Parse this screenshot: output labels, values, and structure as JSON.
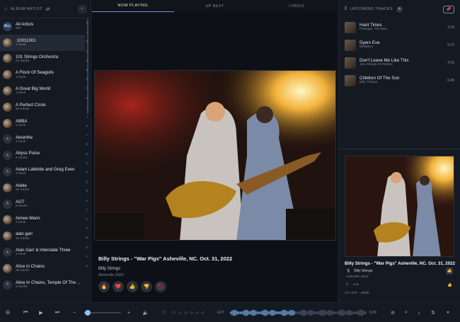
{
  "left_panel": {
    "header_label": "ALBUM ARTIST",
    "artists": [
      {
        "name": "All Artists",
        "sub": "397",
        "avatar": "ALL"
      },
      {
        "name": ".10011001",
        "sub": "1 track",
        "avatar": ""
      },
      {
        "name": "101 Strings Orchestra",
        "sub": "22 tracks",
        "avatar": ""
      },
      {
        "name": "A Flock Of Seagulls",
        "sub": "1 track",
        "avatar": ""
      },
      {
        "name": "A Great Big World",
        "sub": "1 track",
        "avatar": ""
      },
      {
        "name": "A Perfect Circle",
        "sub": "50 tracks",
        "avatar": ""
      },
      {
        "name": "ABBA",
        "sub": "1 track",
        "avatar": ""
      },
      {
        "name": "Absinthe",
        "sub": "1 track",
        "avatar": "A"
      },
      {
        "name": "Abyss Pulse",
        "sub": "2 tracks",
        "avatar": "A"
      },
      {
        "name": "Adam LaMotte and Greg Ewer",
        "sub": "1 track",
        "avatar": "A"
      },
      {
        "name": "Adele",
        "sub": "34 tracks",
        "avatar": ""
      },
      {
        "name": "AGT",
        "sub": "5 tracks",
        "avatar": "A"
      },
      {
        "name": "Aimee Mann",
        "sub": "1 track",
        "avatar": ""
      },
      {
        "name": "alan garr",
        "sub": "10 tracks",
        "avatar": ""
      },
      {
        "name": "Alan Garr & Interstate Three",
        "sub": "1 track",
        "avatar": "A"
      },
      {
        "name": "Alice in Chains",
        "sub": "36 tracks",
        "avatar": ""
      },
      {
        "name": "Alice In Chains, Temple Of The ...",
        "sub": "3 tracks",
        "avatar": "A"
      }
    ],
    "alphabet": [
      "#",
      "A",
      "B",
      "C",
      "D",
      "E",
      "F",
      "G",
      "H",
      "I",
      "J",
      "K",
      "L",
      "M",
      "N",
      "O",
      "P",
      "Q",
      "R",
      "S",
      "T",
      "U",
      "V",
      "W",
      "X",
      "Y",
      "Z"
    ]
  },
  "tabs": [
    {
      "label": "NOW PLAYING",
      "active": true
    },
    {
      "label": "UP NEXT",
      "active": false
    },
    {
      "label": "LYRICS",
      "active": false
    }
  ],
  "now_playing": {
    "title": "Billy Strings - \"War Pigs\" Asheville, NC. Oct. 31, 2022",
    "artist": "Billy Strings",
    "album": "Asheville 2022",
    "reactions": [
      "🔥",
      "❤️",
      "👍",
      "👎",
      "🚫"
    ]
  },
  "upcoming": {
    "header_label": "UPCOMING TRACKS",
    "count": "4",
    "tracks": [
      {
        "title": "Hard Times",
        "sub": "Portugal. The Man",
        "duration": "2:34"
      },
      {
        "title": "Dyers Eve",
        "sub": "Metallica",
        "duration": "5:13"
      },
      {
        "title": "Don't Leave Me Like This",
        "sub": "101 Strings Orchestra",
        "duration": "4:10"
      },
      {
        "title": "Children Of The Sun",
        "sub": "Billy Thorpe",
        "duration": "6:45"
      }
    ]
  },
  "right_info": {
    "title": "Billy Strings - \"War Pigs\" Asheville, NC. Oct. 31, 2022",
    "artist": "Billy Strings",
    "album": "Asheville 2022",
    "tag": "Live",
    "quality": "44.1 kHz · 1500k"
  },
  "player": {
    "time_current": "4:27",
    "time_total": "9:29",
    "volume": 0.1,
    "progress": 0.47,
    "rating": 0
  },
  "colors": {
    "accent": "#5e9bd6",
    "background": "#10141b",
    "panel": "#141922",
    "pin": "#e85a76"
  }
}
